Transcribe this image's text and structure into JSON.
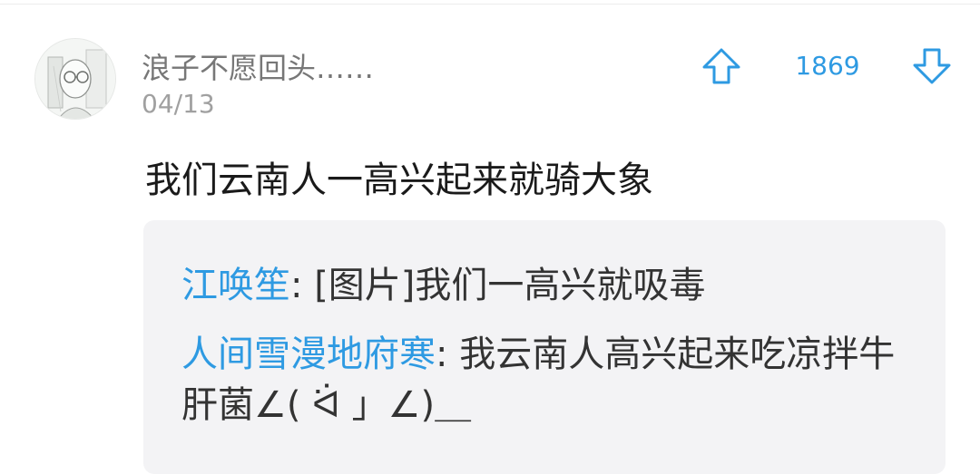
{
  "comment": {
    "username": "浪子不愿回头……",
    "date": "04/13",
    "vote_count": "1869",
    "text": "我们云南人一高兴起来就骑大象"
  },
  "icons": {
    "avatar": "avatar-sketch",
    "upvote": "arrow-up-icon",
    "downvote": "arrow-down-icon"
  },
  "colors": {
    "accent": "#2e9ae2",
    "username": "#777777",
    "date": "#a0a0a0",
    "reply_background": "#f3f3f5"
  },
  "replies": [
    {
      "author": "江唤笙",
      "separator": ": ",
      "text": "[图片]我们一高兴就吸毒"
    },
    {
      "author": "人间雪漫地府寒",
      "separator": ": ",
      "text": "我云南人高兴起来吃凉拌牛肝菌∠( ᐛ 」∠)＿"
    }
  ]
}
